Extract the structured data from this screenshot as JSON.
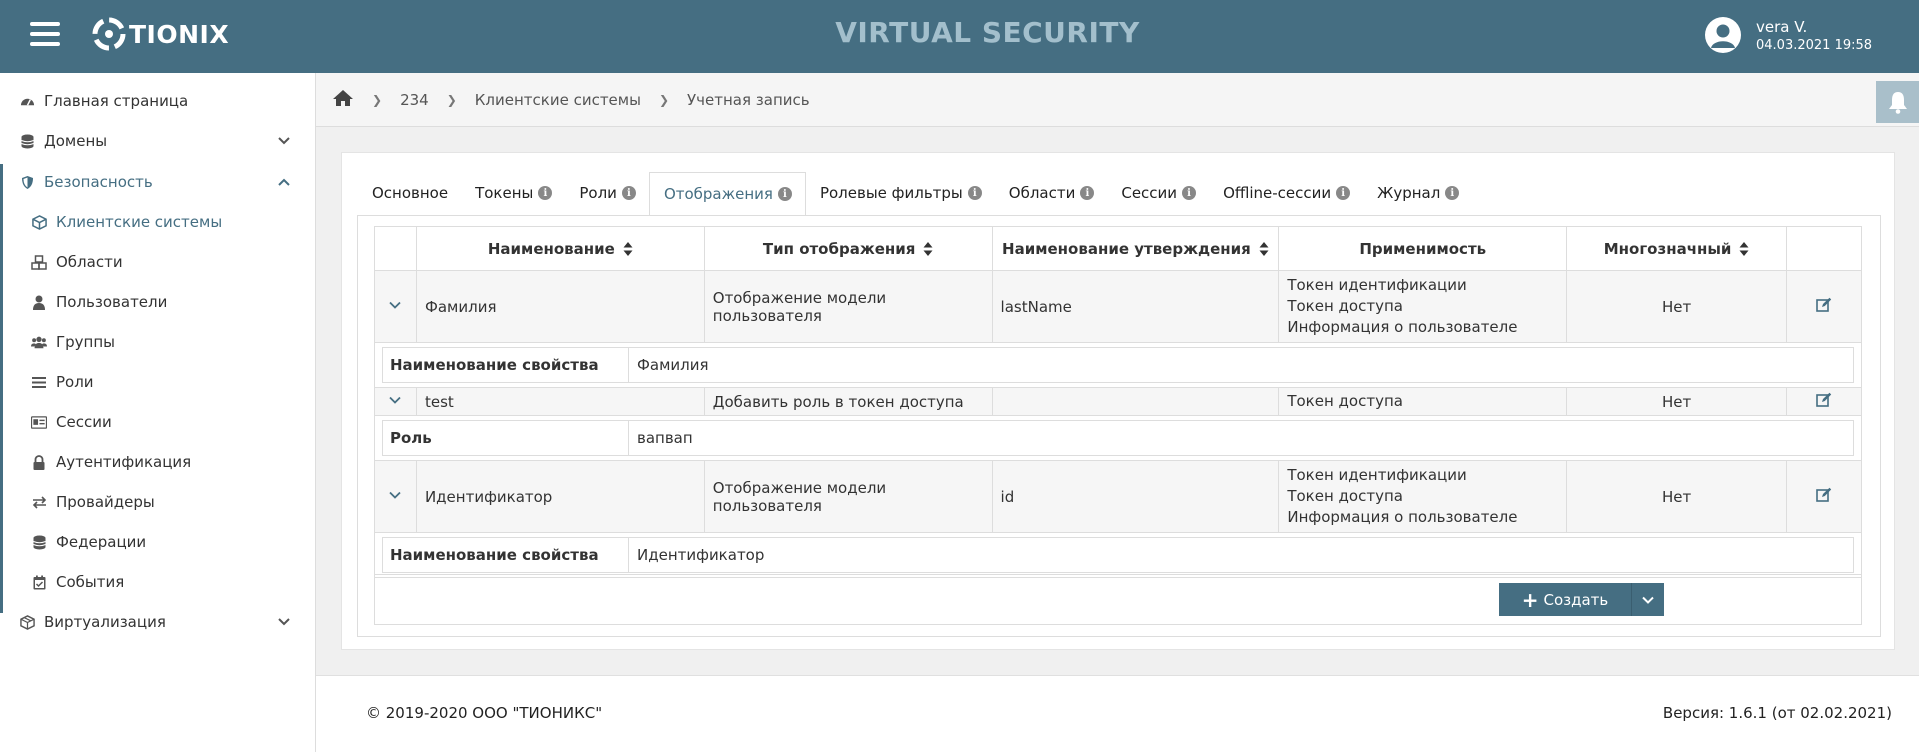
{
  "header": {
    "logo_text": "TIONIX",
    "app_title": "VIRTUAL SECURITY",
    "user_name": "vera V.",
    "user_datetime": "04.03.2021 19:58",
    "colors": {
      "primary": "#456e82",
      "title": "#a3bfcc"
    }
  },
  "sidebar": {
    "items": [
      {
        "label": "Главная страница",
        "icon": "dashboard-icon"
      },
      {
        "label": "Домены",
        "icon": "database-icon"
      },
      {
        "label": "Безопасность",
        "icon": "shield-icon"
      },
      {
        "label": "Клиентские системы",
        "icon": "cube-icon"
      },
      {
        "label": "Области",
        "icon": "cubes-icon"
      },
      {
        "label": "Пользователи",
        "icon": "user-icon"
      },
      {
        "label": "Группы",
        "icon": "users-icon"
      },
      {
        "label": "Роли",
        "icon": "list-icon"
      },
      {
        "label": "Сессии",
        "icon": "id-card-icon"
      },
      {
        "label": "Аутентификация",
        "icon": "lock-icon"
      },
      {
        "label": "Провайдеры",
        "icon": "exchange-icon"
      },
      {
        "label": "Федерации",
        "icon": "database-icon"
      },
      {
        "label": "События",
        "icon": "calendar-check-icon"
      },
      {
        "label": "Виртуализация",
        "icon": "cubes-icon"
      }
    ]
  },
  "breadcrumb": {
    "items": [
      "234",
      "Клиентские системы",
      "Учетная запись"
    ]
  },
  "tabs": [
    {
      "label": "Основное"
    },
    {
      "label": "Токены"
    },
    {
      "label": "Роли"
    },
    {
      "label": "Отображения"
    },
    {
      "label": "Ролевые фильтры"
    },
    {
      "label": "Области"
    },
    {
      "label": "Сессии"
    },
    {
      "label": "Offline-сессии"
    },
    {
      "label": "Журнал"
    }
  ],
  "table": {
    "columns": [
      "Наименование",
      "Тип отображения",
      "Наименование утверждения",
      "Применимость",
      "Многозначный"
    ],
    "rows": [
      {
        "name": "Фамилия",
        "type": "Отображение модели пользователя",
        "claim": "lastName",
        "applicability": [
          "Токен идентификации",
          "Токен доступа",
          "Информация о пользователе"
        ],
        "multi": "Нет",
        "detail_key": "Наименование свойства",
        "detail_value": "Фамилия"
      },
      {
        "name": "test",
        "type": "Добавить роль в токен доступа",
        "claim": "",
        "applicability": [
          "Токен доступа"
        ],
        "multi": "Нет",
        "detail_key": "Роль",
        "detail_value": "вапвап"
      },
      {
        "name": "Идентификатор",
        "type": "Отображение модели пользователя",
        "claim": "id",
        "applicability": [
          "Токен идентификации",
          "Токен доступа",
          "Информация о пользователе"
        ],
        "multi": "Нет",
        "detail_key": "Наименование свойства",
        "detail_value": "Идентификатор"
      }
    ]
  },
  "create_button": {
    "label": "Создать"
  },
  "footer": {
    "copyright": "© 2019-2020 ООО \"ТИОНИКС\"",
    "version": "Версия: 1.6.1 (от 02.02.2021)"
  }
}
